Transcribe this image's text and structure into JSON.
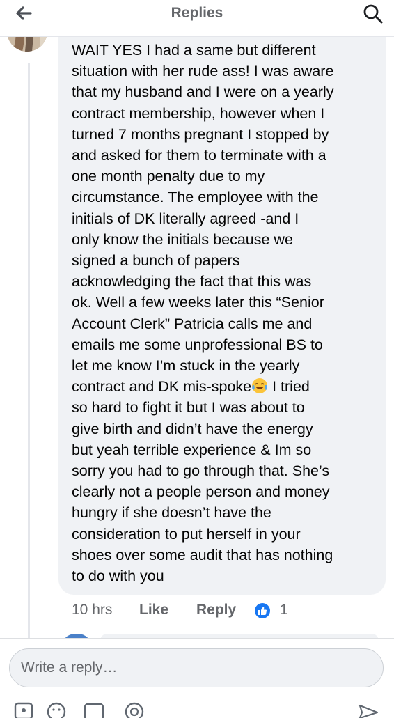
{
  "header": {
    "title": "Replies",
    "back_icon": "arrow-left-icon",
    "search_icon": "search-icon"
  },
  "comment": {
    "lines": [
      "WAIT YES I had a same but different",
      "situation with her rude ass! I was aware",
      "that my husband and I were on a yearly",
      "contract membership, however when I",
      "turned 7 months pregnant I stopped by",
      "and asked for them to terminate with a",
      "one month penalty due to my",
      "circumstance. The employee with the",
      "initials of DK literally agreed -and I",
      "only know the initials because we",
      "signed a bunch of papers",
      "acknowledging the fact that this was",
      "ok. Well a few weeks later this “Senior",
      "Account Clerk” Patricia calls me and",
      "emails me some unprofessional BS to",
      "let me know I’m stuck in the yearly"
    ],
    "line_emoji_before": "contract and DK mis-spoke",
    "emoji": "face-with-tears-of-joy-icon",
    "line_emoji_after": " I tried",
    "lines_after": [
      "so hard to fight it but I was about to",
      "give birth and didn’t have the energy",
      "but yeah terrible experience & Im so",
      "sorry you had to go through that. She’s",
      "clearly not a people person and money",
      "hungry if she doesn’t have the",
      "consideration to put herself in your",
      "shoes over some audit that has nothing",
      "to do with you"
    ],
    "timestamp": "10 hrs",
    "like_label": "Like",
    "reply_label": "Reply",
    "reaction_icon": "thumbs-up-icon",
    "reaction_count": "1"
  },
  "composer": {
    "placeholder": "Write a reply…",
    "value": "",
    "tools": [
      "camera-icon",
      "emoji-icon",
      "gif-icon",
      "sticker-icon",
      "send-icon"
    ]
  },
  "colors": {
    "accent": "#1877f2",
    "bubble": "#f0f2f5",
    "secondary_text": "#65676b"
  }
}
